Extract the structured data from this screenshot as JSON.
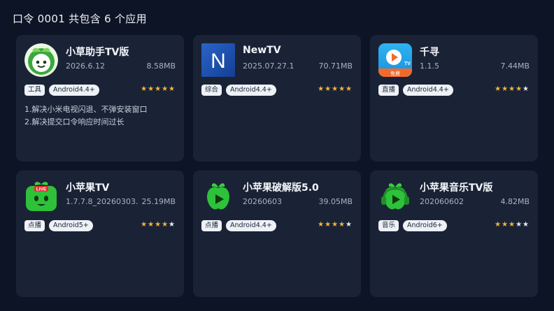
{
  "header": {
    "title": "口令 0001 共包含 6 个应用"
  },
  "apps": [
    {
      "name": "小草助手TV版",
      "version": "2026.6.12",
      "size": "8.58MB",
      "category": "工具",
      "platform": "Android4.4+",
      "rating": 5,
      "notes": [
        "1.解决小米电视闪退、不弹安装窗口",
        "2.解决提交口令响应时间过长"
      ],
      "icon": "green-cartoon-sprout-icon"
    },
    {
      "name": "NewTV",
      "version": "2025.07.27.1",
      "size": "70.71MB",
      "category": "综合",
      "platform": "Android4.4+",
      "rating": 5,
      "notes": [],
      "icon": "newtv-n-letter-icon",
      "icon_letter": "N"
    },
    {
      "name": "千寻",
      "version": "1.1.5",
      "size": "7.44MB",
      "category": "直播",
      "platform": "Android4.4+",
      "rating": 4,
      "notes": [],
      "icon": "qianxun-play-tv-icon",
      "icon_badge": "免费",
      "icon_tv": "TV"
    },
    {
      "name": "小苹果TV",
      "version": "1.7.7.8_20260303…",
      "size": "25.19MB",
      "category": "点播",
      "platform": "Android5+",
      "rating": 4,
      "notes": [],
      "icon": "green-apple-tv-live-icon",
      "icon_badge": "LIVE"
    },
    {
      "name": "小苹果破解版5.0",
      "version": "20260603",
      "size": "39.05MB",
      "category": "点播",
      "platform": "Android4.4+",
      "rating": 4,
      "notes": [],
      "icon": "green-apple-play-icon"
    },
    {
      "name": "小苹果音乐TV版",
      "version": "202060602",
      "size": "4.82MB",
      "category": "音乐",
      "platform": "Android6+",
      "rating": 3,
      "notes": [],
      "icon": "green-apple-headphones-icon"
    }
  ],
  "max_rating": 5,
  "colors": {
    "background": "#0d1425",
    "card": "#1a2336",
    "star": "#f4b43c",
    "accent_green": "#2db83a"
  }
}
